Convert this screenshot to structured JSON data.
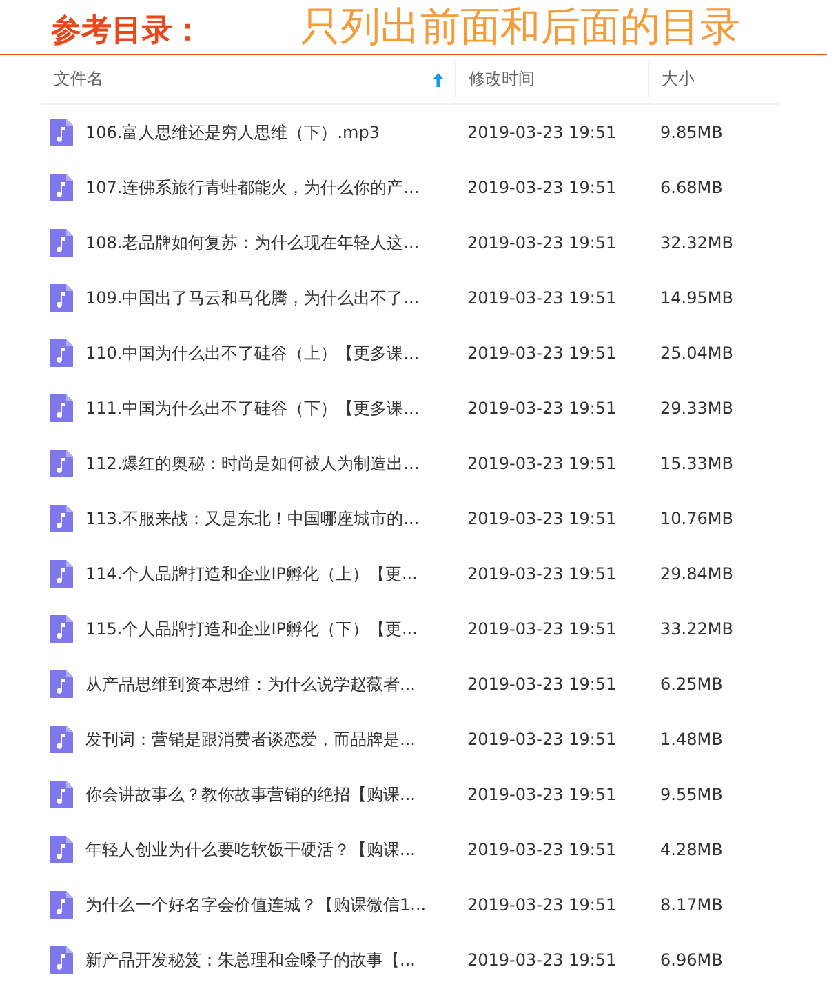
{
  "banner": {
    "label": "参考目录：",
    "note": "只列出前面和后面的目录"
  },
  "table": {
    "columns": [
      {
        "label": "文件名",
        "sorted": true
      },
      {
        "label": "修改时间",
        "sorted": false
      },
      {
        "label": "大小",
        "sorted": false
      }
    ],
    "rows": [
      {
        "name": "106.富人思维还是穷人思维（下）.mp3",
        "modified": "2019-03-23 19:51",
        "size": "9.85MB"
      },
      {
        "name": "107.连佛系旅行青蛙都能火，为什么你的产...",
        "modified": "2019-03-23 19:51",
        "size": "6.68MB"
      },
      {
        "name": "108.老品牌如何复苏：为什么现在年轻人这...",
        "modified": "2019-03-23 19:51",
        "size": "32.32MB"
      },
      {
        "name": "109.中国出了马云和马化腾，为什么出不了...",
        "modified": "2019-03-23 19:51",
        "size": "14.95MB"
      },
      {
        "name": "110.中国为什么出不了硅谷（上）【更多课...",
        "modified": "2019-03-23 19:51",
        "size": "25.04MB"
      },
      {
        "name": "111.中国为什么出不了硅谷（下）【更多课...",
        "modified": "2019-03-23 19:51",
        "size": "29.33MB"
      },
      {
        "name": "112.爆红的奥秘：时尚是如何被人为制造出...",
        "modified": "2019-03-23 19:51",
        "size": "15.33MB"
      },
      {
        "name": "113.不服来战：又是东北！中国哪座城市的...",
        "modified": "2019-03-23 19:51",
        "size": "10.76MB"
      },
      {
        "name": "114.个人品牌打造和企业IP孵化（上）【更...",
        "modified": "2019-03-23 19:51",
        "size": "29.84MB"
      },
      {
        "name": "115.个人品牌打造和企业IP孵化（下）【更...",
        "modified": "2019-03-23 19:51",
        "size": "33.22MB"
      },
      {
        "name": "从产品思维到资本思维：为什么说学赵薇者...",
        "modified": "2019-03-23 19:51",
        "size": "6.25MB"
      },
      {
        "name": "发刊词：营销是跟消费者谈恋爱，而品牌是...",
        "modified": "2019-03-23 19:51",
        "size": "1.48MB"
      },
      {
        "name": "你会讲故事么？教你故事营销的绝招【购课...",
        "modified": "2019-03-23 19:51",
        "size": "9.55MB"
      },
      {
        "name": "年轻人创业为什么要吃软饭干硬活？【购课...",
        "modified": "2019-03-23 19:51",
        "size": "4.28MB"
      },
      {
        "name": "为什么一个好名字会价值连城？【购课微信1...",
        "modified": "2019-03-23 19:51",
        "size": "8.17MB"
      },
      {
        "name": "新产品开发秘笈：朱总理和金嗓子的故事【...",
        "modified": "2019-03-23 19:51",
        "size": "6.96MB"
      }
    ]
  }
}
